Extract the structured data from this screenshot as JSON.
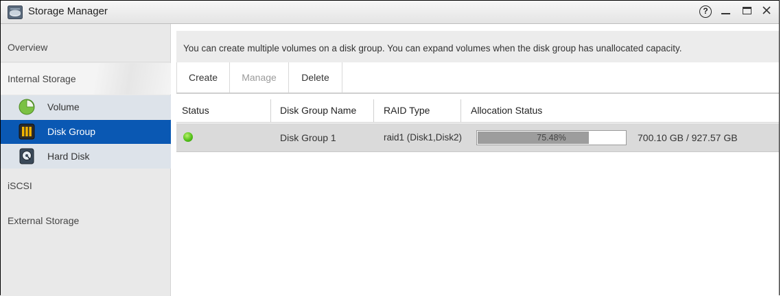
{
  "window": {
    "title": "Storage Manager",
    "controls": {
      "help": "?",
      "icons": [
        "help-icon",
        "minimize-icon",
        "maximize-icon",
        "close-icon"
      ]
    }
  },
  "sidebar": {
    "overview": "Overview",
    "internal_storage": "Internal Storage",
    "sub_items": [
      {
        "label": "Volume",
        "icon": "volume-icon",
        "selected": false
      },
      {
        "label": "Disk Group",
        "icon": "disk-group-icon",
        "selected": true
      },
      {
        "label": "Hard Disk",
        "icon": "hard-disk-icon",
        "selected": false
      }
    ],
    "iscsi": "iSCSI",
    "external_storage": "External Storage"
  },
  "main": {
    "info": "You can create multiple volumes on a disk group. You can expand volumes when the disk group has unallocated capacity.",
    "toolbar": {
      "create": "Create",
      "manage": "Manage",
      "delete": "Delete"
    },
    "table": {
      "headers": [
        "Status",
        "Disk Group Name",
        "RAID Type",
        "Allocation Status"
      ],
      "rows": [
        {
          "status": "ok",
          "name": "Disk Group 1",
          "raid": "raid1 (Disk1,Disk2)",
          "allocation_percent": 75.48,
          "allocation_label": "75.48%",
          "capacity": "700.10 GB / 927.57 GB"
        }
      ]
    }
  },
  "colors": {
    "selected_item": "#0a58b3",
    "status_ok": "#55c21a",
    "progress_fill": "#9d9d9d",
    "disabled_text": "#9b9b9b"
  }
}
